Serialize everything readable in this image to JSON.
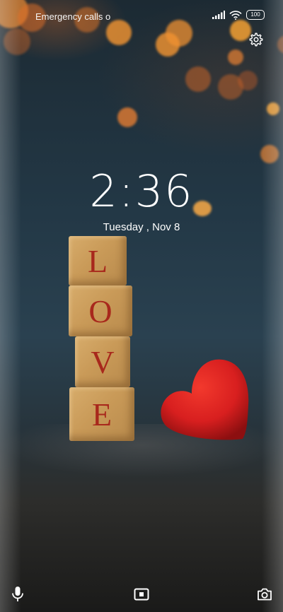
{
  "status_bar": {
    "notification_text": "Emergency calls o",
    "battery_level": "100",
    "signal_icon": "signal-icon",
    "wifi_icon": "wifi-icon"
  },
  "lock_screen": {
    "time": "2:36",
    "date": "Tuesday , Nov 8",
    "settings_icon": "gear-icon"
  },
  "wallpaper": {
    "blocks": [
      "L",
      "O",
      "V",
      "E"
    ],
    "heart_color": "#d81f1f",
    "block_letter_color": "#a8281c"
  },
  "bottom_bar": {
    "left_icon": "microphone-icon",
    "center_icon": "screen-icon",
    "right_icon": "camera-icon"
  }
}
